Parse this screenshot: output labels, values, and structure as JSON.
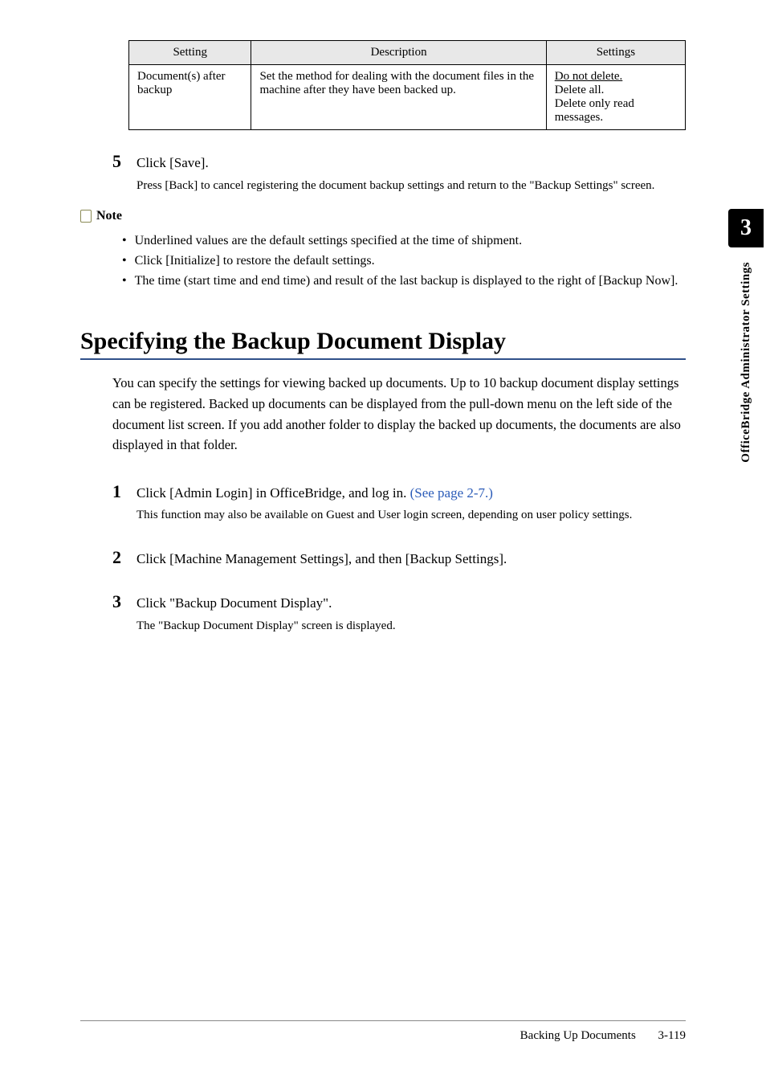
{
  "table": {
    "headers": [
      "Setting",
      "Description",
      "Settings"
    ],
    "row": {
      "setting": "Document(s) after backup",
      "description": "Set the method for dealing with the document files in the machine after they have been backed up.",
      "settings_default": "Do not delete.",
      "settings_rest": "Delete all.\nDelete only read messages."
    }
  },
  "step5": {
    "num": "5",
    "main": "Click [Save].",
    "sub": "Press [Back] to cancel registering the document backup settings and return to the \"Backup Settings\" screen."
  },
  "note": {
    "label": "Note",
    "items": [
      "Underlined values are the default settings specified at the time of shipment.",
      "Click [Initialize] to restore the default settings.",
      "The time (start time and end time) and result of the last backup is displayed to the right of [Backup Now]."
    ]
  },
  "section": {
    "title": "Specifying the Backup Document Display",
    "intro": "You can specify the settings for viewing backed up documents. Up to 10 backup document display settings can be registered. Backed up documents can be displayed from the pull-down menu on the left side of the document list screen. If you add another folder to display the backed up documents, the documents are also displayed in that folder."
  },
  "step1": {
    "num": "1",
    "main_pre": "Click [Admin Login] in OfficeBridge, and log in. ",
    "main_link": "(See page 2-7.)",
    "sub": "This function may also be available on Guest and User login screen, depending on user policy settings."
  },
  "step2": {
    "num": "2",
    "main": "Click [Machine Management Settings], and then [Backup Settings]."
  },
  "step3": {
    "num": "3",
    "main": "Click \"Backup Document Display\".",
    "sub": "The \"Backup Document Display\" screen is displayed."
  },
  "side": {
    "chapter": "3",
    "label": "OfficeBridge Administrator Settings"
  },
  "footer": {
    "title": "Backing Up Documents",
    "page": "3-119"
  }
}
